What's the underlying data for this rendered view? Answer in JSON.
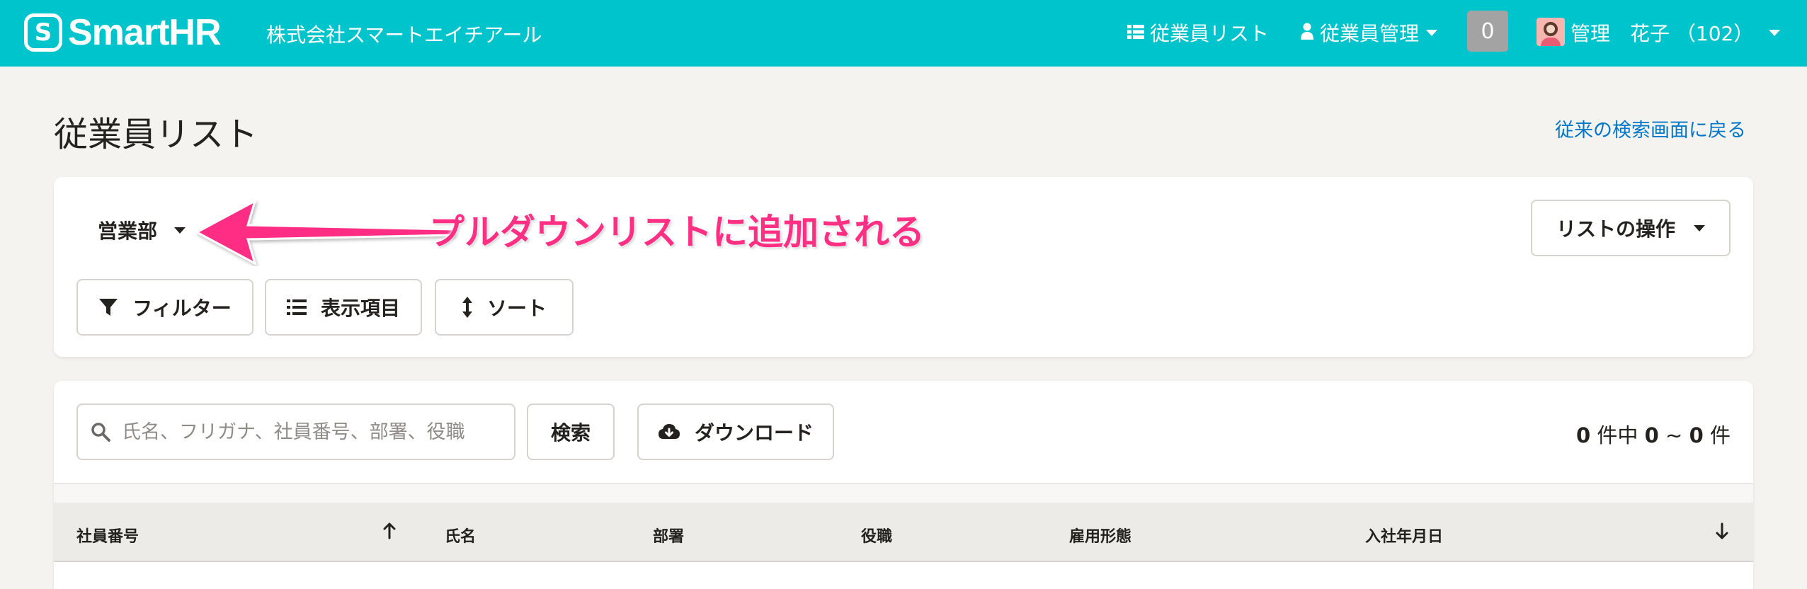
{
  "header": {
    "logo_text": "SmartHR",
    "logo_mark": "S",
    "company_name": "株式会社スマートエイチアール",
    "nav_employee_list": "従業員リスト",
    "nav_employee_manage": "従業員管理",
    "notification_count": "0",
    "user_name": "管理　花子 （102）",
    "brand_color": "#00c4cc"
  },
  "page": {
    "title": "従業員リスト",
    "back_link": "従来の検索画面に戻る"
  },
  "list_panel": {
    "selected_list": "営業部",
    "annotation": "プルダウンリストに追加される",
    "list_ops_label": "リストの操作",
    "filter_label": "フィルター",
    "columns_label": "表示項目",
    "sort_label": "ソート"
  },
  "results_panel": {
    "search_placeholder": "氏名、フリガナ、社員番号、部署、役職",
    "search_button": "検索",
    "download_button": "ダウンロード",
    "count_total": "0",
    "count_text_1": " 件中 ",
    "count_from": "0",
    "count_tilde": " ~ ",
    "count_to": "0",
    "count_text_2": " 件"
  },
  "table": {
    "columns": [
      "社員番号",
      "氏名",
      "部署",
      "役職",
      "雇用形態",
      "入社年月日"
    ]
  },
  "icons": {
    "list": "list-icon",
    "user": "user-icon",
    "filter": "filter-icon",
    "columns": "columns-list-icon",
    "sort": "sort-icon",
    "search": "search-icon",
    "download": "cloud-download-icon",
    "sort_asc": "arrow-up-icon",
    "sort_desc": "arrow-down-icon"
  },
  "annotation_color": "#ff2f84"
}
